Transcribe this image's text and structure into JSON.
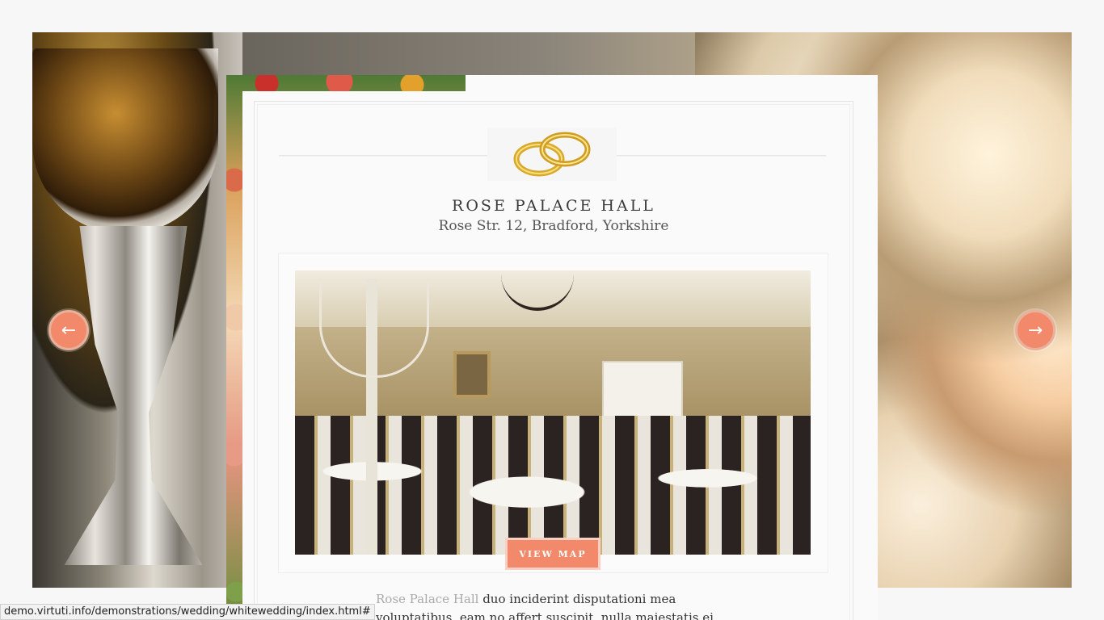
{
  "venue": {
    "title": "ROSE PALACE HALL",
    "address": "Rose Str. 12, Bradford, Yorkshire",
    "button_label": "VIEW MAP",
    "intro_highlight": "Rose Palace Hall",
    "intro_line1_rest": " duo inciderint disputationi mea",
    "intro_line2": "voluptatibus, eam no affert suscipit, nulla maiestatis ei"
  },
  "slider": {
    "prev_glyph": "←",
    "next_glyph": "→"
  },
  "status_bar": {
    "url": "demo.virtuti.info/demonstrations/wedding/whitewedding/index.html#"
  },
  "icons": {
    "rings": "wedding-rings-icon"
  },
  "colors": {
    "accent": "#f2896b",
    "text": "#3a3a3a"
  }
}
